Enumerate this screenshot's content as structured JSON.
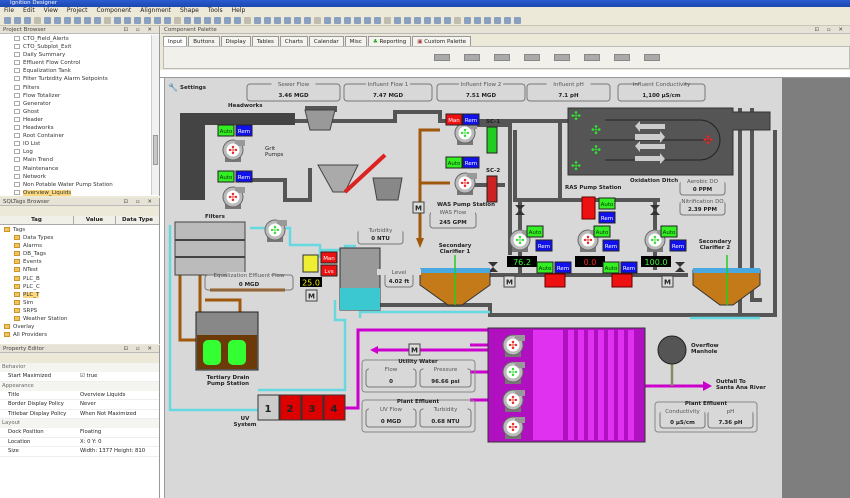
{
  "window": {
    "title": "Ignition Designer"
  },
  "menu": [
    "File",
    "Edit",
    "View",
    "Project",
    "Component",
    "Alignment",
    "Shape",
    "Tools",
    "Help"
  ],
  "project_browser": {
    "title": "Project Browser",
    "items": [
      "CTO_Field_Alerts",
      "CTO_Subplot_Exit",
      "Daily Summary",
      "Effluent Flow Control",
      "Equalization Tank",
      "Filter Turbidity Alarm Setpoints",
      "Filters",
      "Flow Totalizer",
      "Generator",
      "Ghost",
      "Header",
      "Headworks",
      "Root Container",
      "IO List",
      "Log",
      "Main Trend",
      "Maintenance",
      "Network",
      "Non Potable Water Pump Station",
      "Overview_Liquids"
    ],
    "selected": "Overview_Liquids"
  },
  "tag_browser": {
    "title": "SQLTags Browser",
    "columns": [
      "Tag",
      "Value",
      "Data Type"
    ],
    "items": [
      "Tags",
      "Data Types",
      "Alarms",
      "DB_Tags",
      "Events",
      "NTest",
      "PLC_B",
      "PLC_C",
      "PLC_T",
      "Sim",
      "SRPS",
      "Weather Station",
      "Overlay",
      "All Providers"
    ],
    "selected": "PLC_T"
  },
  "property_editor": {
    "title": "Property Editor",
    "categories": {
      "behavior": "Behavior",
      "appearance": "Appearance",
      "layout": "Layout"
    },
    "rows": [
      {
        "k": "Start Maximized",
        "v": "true"
      },
      {
        "k": "Title",
        "v": "Overview Liquids"
      },
      {
        "k": "Border Display Policy",
        "v": "Never"
      },
      {
        "k": "Titlebar Display Policy",
        "v": "When Not Maximized"
      },
      {
        "k": "Dock Position",
        "v": "Floating"
      },
      {
        "k": "Location",
        "v": "X: 0      Y: 0"
      },
      {
        "k": "Size",
        "v": "Width: 1377   Height: 810"
      }
    ]
  },
  "palette": {
    "title": "Component Palette",
    "tabs": [
      "Input",
      "Buttons",
      "Display",
      "Tables",
      "Charts",
      "Calendar",
      "Misc",
      "Reporting",
      "Custom Palette"
    ],
    "active": "Input"
  },
  "diagram": {
    "settings": "Settings",
    "readouts": [
      {
        "label": "Sewer Flow",
        "value": "3.46 MGD"
      },
      {
        "label": "Influent Flow 1",
        "value": "7.47 MGD"
      },
      {
        "label": "Influent Flow 2",
        "value": "7.51 MGD"
      },
      {
        "label": "Influent pH",
        "value": "7.1 pH"
      },
      {
        "label": "Influent Conductivity",
        "value": "1,100 µS/cm"
      }
    ],
    "headworks": "Headworks",
    "grit_pumps": [
      "Grit",
      "Pumps"
    ],
    "auto": "Auto",
    "rem": "Rem",
    "man": "Man",
    "lvs": "Lvs",
    "sc1": "SC-1",
    "sc2": "SC-2",
    "was_station": "WAS Pump Station",
    "was_flow": {
      "label": "WAS Flow",
      "value": "245 GPM"
    },
    "oxidation_ditch": "Oxidation Ditch",
    "aerobic_do": {
      "label": "Aerobic DO",
      "value": "0 PPM"
    },
    "nitrification_do": {
      "label": "Nitrification DO",
      "value": "2.39 PPM"
    },
    "ras_station": "RAS Pump Station",
    "ras_speeds": [
      "76.2",
      "0.0",
      "100.0"
    ],
    "clarifier1": [
      "Secondary",
      "Clarifier 1"
    ],
    "clarifier2": [
      "Secondary",
      "Clarifier 2"
    ],
    "filters": "Filters",
    "turbidity": {
      "label": "Turbidity",
      "value": "0 NTU"
    },
    "level": {
      "label": "Level",
      "value": "4.02 ft"
    },
    "eq_flow": {
      "label": "Equalization Effluent Flow",
      "value": "0 MGD"
    },
    "eq_display": "25.0",
    "tertiary": [
      "Tertiary Drain",
      "Pump Station"
    ],
    "uv_system": [
      "UV",
      "System"
    ],
    "uv_banks": [
      "1",
      "2",
      "3",
      "4"
    ],
    "utility_water": {
      "title": "Utility Water",
      "flow_label": "Flow",
      "flow": "0",
      "pressure_label": "Pressure",
      "pressure": "96.66 psi"
    },
    "plant_effluent_left": {
      "title": "Plant Effluent",
      "uv_flow_label": "UV Flow",
      "uv_flow": "0 MGD",
      "turbidity_label": "Turbidity",
      "turbidity": "0.68 NTU"
    },
    "overflow": [
      "Overflow",
      "Manhole"
    ],
    "outfall": [
      "Outfall To",
      "Santa Ana River"
    ],
    "plant_effluent_right": {
      "title": "Plant Effluent",
      "cond_label": "Conductivity",
      "cond": "0 µS/cm",
      "ph_label": "pH",
      "ph": "7.36 pH"
    },
    "motor": "M",
    "colors": {
      "running": "#33dd33",
      "stopped": "#ee2222",
      "auto": "#33ee22",
      "rem": "#1111ee",
      "man": "#ee1111",
      "pipe": "#555555",
      "water": "#66d8e0",
      "sludge": "#8a4a0a",
      "uv": "#cc00cc"
    }
  }
}
